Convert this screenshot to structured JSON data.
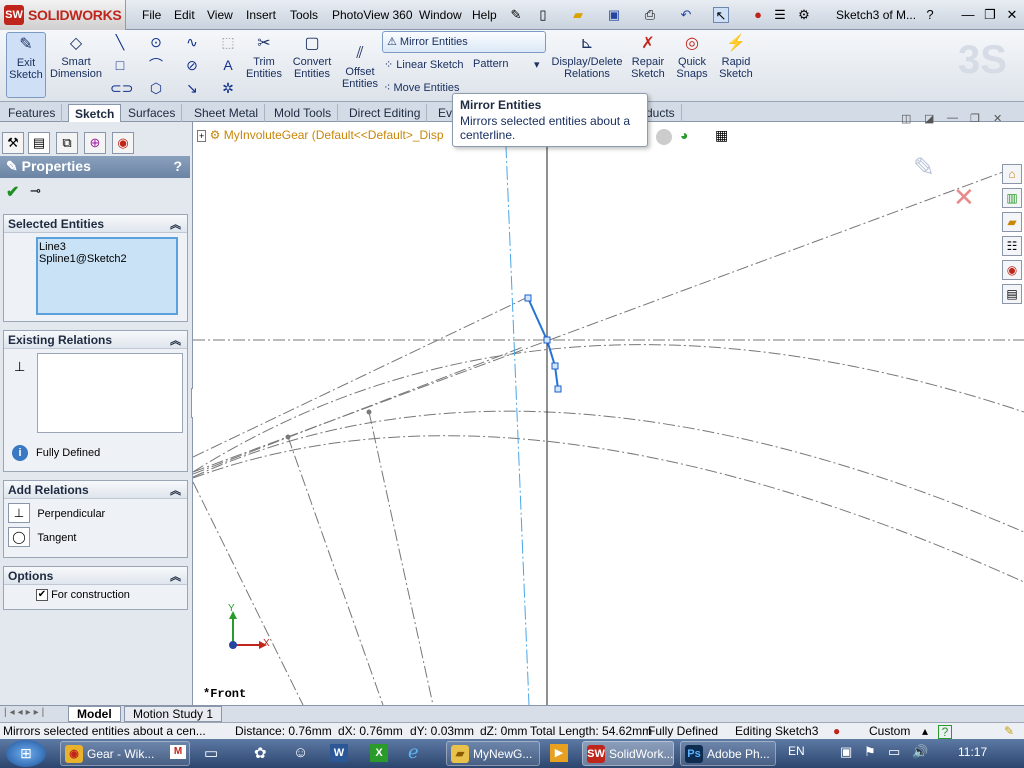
{
  "app": {
    "logo_text": "SOLIDWORKS",
    "doc_title": "Sketch3 of M..."
  },
  "menu": [
    "File",
    "Edit",
    "View",
    "Insert",
    "Tools",
    "PhotoView 360",
    "Window",
    "Help"
  ],
  "commands": {
    "exit_sketch": "Exit Sketch",
    "smart_dimension": "Smart Dimension",
    "trim_entities": "Trim Entities",
    "convert_entities": "Convert Entities",
    "offset_entities": "Offset Entities",
    "mirror_entities": "Mirror Entities",
    "linear_sketch": "Linear Sketch",
    "pattern": "Pattern",
    "move_entities": "Move Entities",
    "display_delete_relations": "Display/Delete Relations",
    "repair_sketch": "Repair Sketch",
    "quick_snaps": "Quick Snaps",
    "rapid_sketch": "Rapid Sketch"
  },
  "tabs": [
    "Features",
    "Sketch",
    "Surfaces",
    "Sheet Metal",
    "Mold Tools",
    "Direct Editing",
    "Ev",
    "ducts"
  ],
  "active_tab": "Sketch",
  "tooltip": {
    "title": "Mirror Entities",
    "description": "Mirrors selected entities about a centerline."
  },
  "feature_tree": {
    "part": "MyInvoluteGear",
    "config": "(Default<<Default>_Disp"
  },
  "property_manager": {
    "title": "Properties",
    "selected_entities": {
      "header": "Selected Entities",
      "items": [
        "Line3",
        "Spline1@Sketch2"
      ]
    },
    "existing_relations": {
      "header": "Existing Relations",
      "status": "Fully Defined"
    },
    "add_relations": {
      "header": "Add Relations",
      "items": [
        "Perpendicular",
        "Tangent"
      ]
    },
    "options": {
      "header": "Options",
      "for_construction": "For construction",
      "for_construction_checked": true
    }
  },
  "viewport": {
    "view_label": "*Front",
    "axis_x": "X",
    "axis_y": "Y"
  },
  "bottom_tabs": [
    "Model",
    "Motion Study 1"
  ],
  "status": {
    "message": "Mirrors selected entities about a cen...",
    "distance": "Distance: 0.76mm",
    "dx": "dX: 0.76mm",
    "dy": "dY: 0.03mm",
    "dz": "dZ: 0mm",
    "total_length": "Total Length: 54.62mm",
    "defined": "Fully Defined",
    "editing": "Editing Sketch3",
    "units": "Custom"
  },
  "taskbar": {
    "items": [
      "Gear - Wik...",
      "MyNewG...",
      "SolidWork...",
      "Adobe Ph..."
    ],
    "language": "EN",
    "clock": "11:17"
  },
  "colors": {
    "accent": "#c0251b",
    "sketch_blue": "#1e5fcc",
    "selection": "#c9e2f5"
  }
}
